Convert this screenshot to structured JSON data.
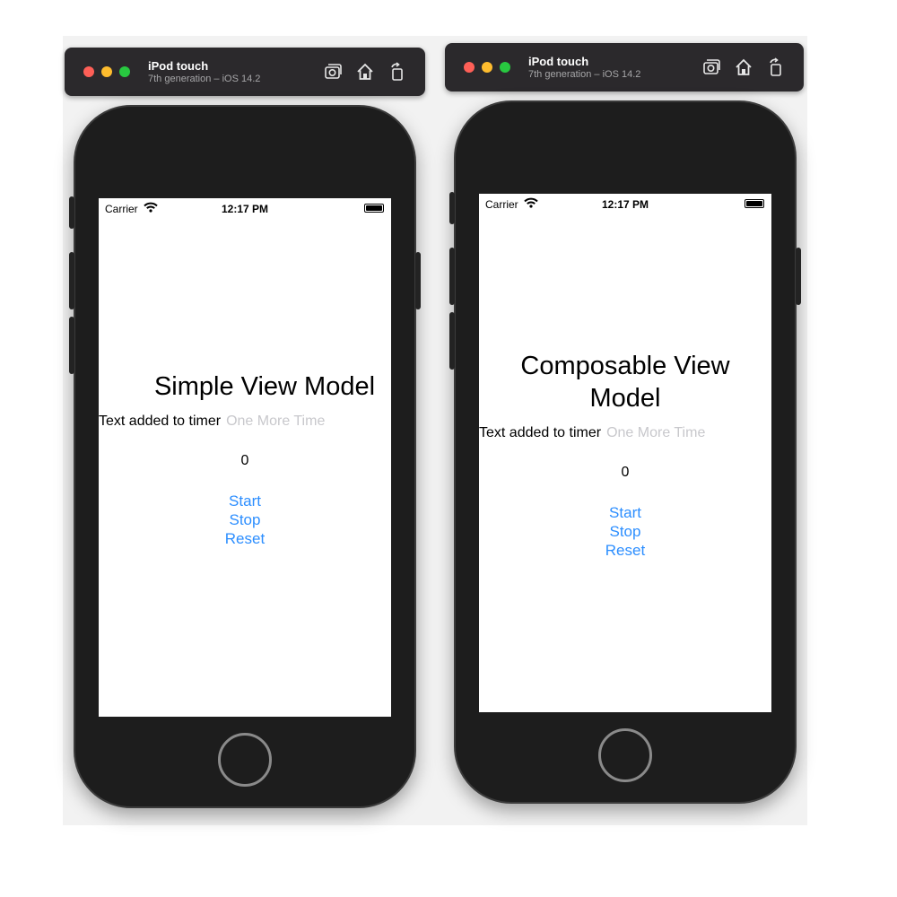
{
  "simulators": [
    {
      "window": {
        "device_name": "iPod touch",
        "subtitle": "7th generation – iOS 14.2"
      },
      "status_bar": {
        "carrier": "Carrier",
        "time": "12:17 PM"
      },
      "title": "Simple View Model",
      "text_label": "Text added to timer",
      "text_placeholder": "One More Time",
      "counter": "0",
      "buttons": {
        "start": "Start",
        "stop": "Stop",
        "reset": "Reset"
      }
    },
    {
      "window": {
        "device_name": "iPod touch",
        "subtitle": "7th generation – iOS 14.2"
      },
      "status_bar": {
        "carrier": "Carrier",
        "time": "12:17 PM"
      },
      "title": "Composable View Model",
      "text_label": "Text added to timer",
      "text_placeholder": "One More Time",
      "counter": "0",
      "buttons": {
        "start": "Start",
        "stop": "Stop",
        "reset": "Reset"
      }
    }
  ],
  "colors": {
    "titlebar": "#2b292c",
    "device_body": "#1d1d1d",
    "button_blue": "#2c8eff",
    "placeholder_gray": "#c8c8cc"
  },
  "icons": [
    "screenshot-icon",
    "home-icon",
    "rotate-icon",
    "wifi-icon",
    "battery-icon"
  ]
}
